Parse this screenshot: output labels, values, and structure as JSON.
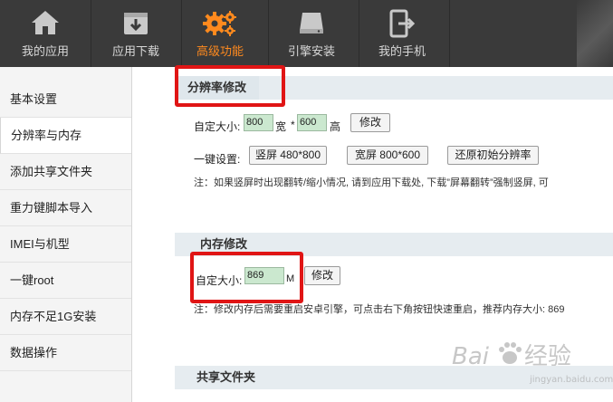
{
  "nav": {
    "items": [
      {
        "label": "我的应用",
        "icon": "home-icon"
      },
      {
        "label": "应用下载",
        "icon": "download-box-icon"
      },
      {
        "label": "高级功能",
        "icon": "gears-icon",
        "active": true
      },
      {
        "label": "引擎安装",
        "icon": "drive-icon"
      },
      {
        "label": "我的手机",
        "icon": "phone-exit-icon"
      }
    ],
    "active_color": "#ff8a1e"
  },
  "sidebar": {
    "items": [
      {
        "label": "基本设置"
      },
      {
        "label": "分辨率与内存",
        "active": true
      },
      {
        "label": "添加共享文件夹"
      },
      {
        "label": "重力键脚本导入"
      },
      {
        "label": "IMEI与机型"
      },
      {
        "label": "一键root"
      },
      {
        "label": "内存不足1G安装"
      },
      {
        "label": "数据操作"
      }
    ]
  },
  "resolution": {
    "title": "分辨率修改",
    "custom_label": "自定大小:",
    "width_value": "800",
    "width_unit": "宽",
    "times": "*",
    "height_value": "600",
    "height_unit": "高",
    "modify_button": "修改",
    "preset_label": "一键设置:",
    "portrait_button": "竖屏 480*800",
    "landscape_button": "宽屏 800*600",
    "restore_button": "还原初始分辨率",
    "note": "注：如果竖屏时出现翻转/缩小情况, 请到应用下载处, 下载”屏幕翻转”强制竖屏, 可"
  },
  "memory": {
    "title": "内存修改",
    "custom_label": "自定大小:",
    "value": "869",
    "unit": "M",
    "modify_button": "修改",
    "note": "注：修改内存后需要重启安卓引擎，可点击右下角按钮快速重启，推荐内存大小: 869"
  },
  "shared": {
    "title": "共享文件夹"
  },
  "watermark": {
    "text": "Baidu经验",
    "sub": "jingyan.baidu.com"
  },
  "colors": {
    "highlight": "#e01515",
    "input_bg": "#cbe8cf",
    "nav_bg": "#3a3a3a"
  }
}
